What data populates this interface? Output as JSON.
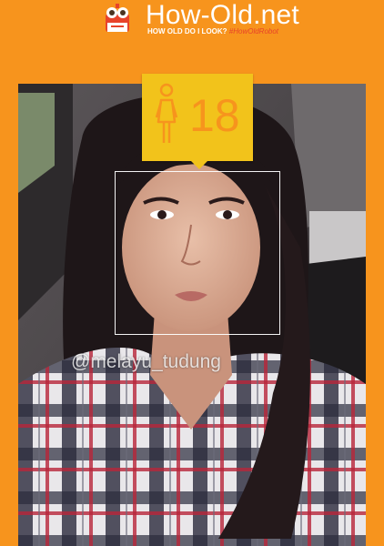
{
  "header": {
    "title": "How-Old.net",
    "tagline": "HOW OLD DO I LOOK?",
    "hashtag": "#HowOldRobot",
    "logo_icon": "robot-head-icon"
  },
  "result": {
    "age": "18",
    "gender_icon": "female-icon"
  },
  "watermark": "@melayu_tudung",
  "colors": {
    "background": "#F7941D",
    "badge": "#F2C31B",
    "hashtag": "#E8432A"
  }
}
